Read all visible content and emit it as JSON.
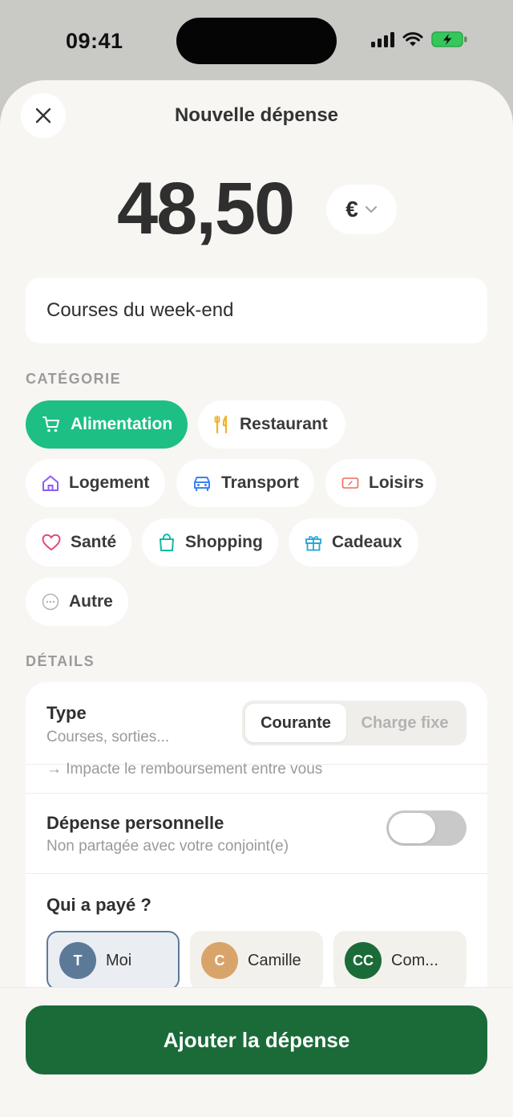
{
  "status": {
    "time": "09:41"
  },
  "header": {
    "title": "Nouvelle dépense",
    "close_icon": "close-icon"
  },
  "amount": {
    "value": "48,50",
    "currency": "€"
  },
  "description": {
    "value": "Courses du week-end"
  },
  "category": {
    "label": "CATÉGORIE",
    "selected": "Alimentation",
    "items": [
      {
        "label": "Alimentation",
        "icon": "cart-icon",
        "color": "#ffffff"
      },
      {
        "label": "Restaurant",
        "icon": "cutlery-icon",
        "color": "#f0b429"
      },
      {
        "label": "Logement",
        "icon": "house-icon",
        "color": "#8b5cf6"
      },
      {
        "label": "Transport",
        "icon": "car-icon",
        "color": "#3b82f6"
      },
      {
        "label": "Loisirs",
        "icon": "ticket-icon",
        "color": "#ef6a5a"
      },
      {
        "label": "Santé",
        "icon": "heart-icon",
        "color": "#e5487c"
      },
      {
        "label": "Shopping",
        "icon": "bag-icon",
        "color": "#14b8a6"
      },
      {
        "label": "Cadeaux",
        "icon": "gift-icon",
        "color": "#22a6d6"
      },
      {
        "label": "Autre",
        "icon": "dots-icon",
        "color": "#9a9a9a"
      }
    ]
  },
  "details": {
    "label": "DÉTAILS",
    "type": {
      "title": "Type",
      "subtitle": "Courses, sorties...",
      "options": [
        "Courante",
        "Charge fixe"
      ],
      "selected": "Courante",
      "hint": "→ Impacte le remboursement entre vous"
    },
    "personal": {
      "title": "Dépense personnelle",
      "subtitle": "Non partagée avec votre conjoint(e)",
      "enabled": false
    },
    "payer": {
      "title": "Qui a payé ?",
      "selected": "Moi",
      "options": [
        {
          "initials": "T",
          "name": "Moi",
          "color": "#5c7a98"
        },
        {
          "initials": "C",
          "name": "Camille",
          "color": "#d9a46a"
        },
        {
          "initials": "CC",
          "name": "Com...",
          "color": "#1b6b39"
        }
      ]
    }
  },
  "footer": {
    "submit_label": "Ajouter la dépense"
  },
  "colors": {
    "accent": "#1dbf85",
    "primary_button": "#1b6b39"
  }
}
